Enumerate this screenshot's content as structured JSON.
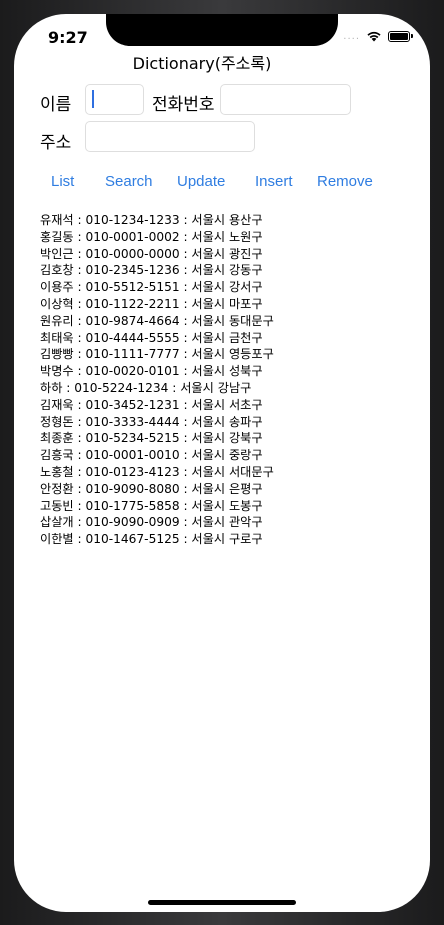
{
  "status_bar": {
    "time": "9:27",
    "signal": "....",
    "wifi_icon": "wifi-icon",
    "battery_icon": "battery-icon"
  },
  "nav": {
    "title": "Dictionary(주소록)"
  },
  "form": {
    "name_label": "이름",
    "name_value": "",
    "phone_label": "전화번호",
    "phone_value": "",
    "address_label": "주소",
    "address_value": ""
  },
  "buttons": {
    "list": "List",
    "search": "Search",
    "update": "Update",
    "insert": "Insert",
    "remove": "Remove"
  },
  "results": [
    "유재석 : 010-1234-1233 : 서울시 용산구",
    "홍길동 : 010-0001-0002 : 서울시 노원구",
    "박인근 : 010-0000-0000 : 서울시 광진구",
    "김호창 : 010-2345-1236 : 서울시 강동구",
    "이용주 : 010-5512-5151 : 서울시 강서구",
    "이상혁 : 010-1122-2211 : 서울시 마포구",
    "원유리 : 010-9874-4664 : 서울시 동대문구",
    "최태욱 : 010-4444-5555 : 서울시 금천구",
    "김빵빵 : 010-1111-7777 : 서울시 영등포구",
    "박명수 : 010-0020-0101 : 서울시 성북구",
    "하하 : 010-5224-1234 : 서울시 강남구",
    "김재욱 : 010-3452-1231 : 서울시 서초구",
    "정형돈 : 010-3333-4444 : 서울시 송파구",
    "최종훈 : 010-5234-5215 : 서울시 강북구",
    "김흥국 : 010-0001-0010 : 서울시 중랑구",
    "노홍철 : 010-0123-4123 : 서울시 서대문구",
    "안정환 : 010-9090-8080 : 서울시 은평구",
    "고동빈 : 010-1775-5858 : 서울시 도봉구",
    "삽살개 : 010-9090-0909 : 서울시 관악구",
    "이한별 : 010-1467-5125 : 서울시 구로구"
  ]
}
